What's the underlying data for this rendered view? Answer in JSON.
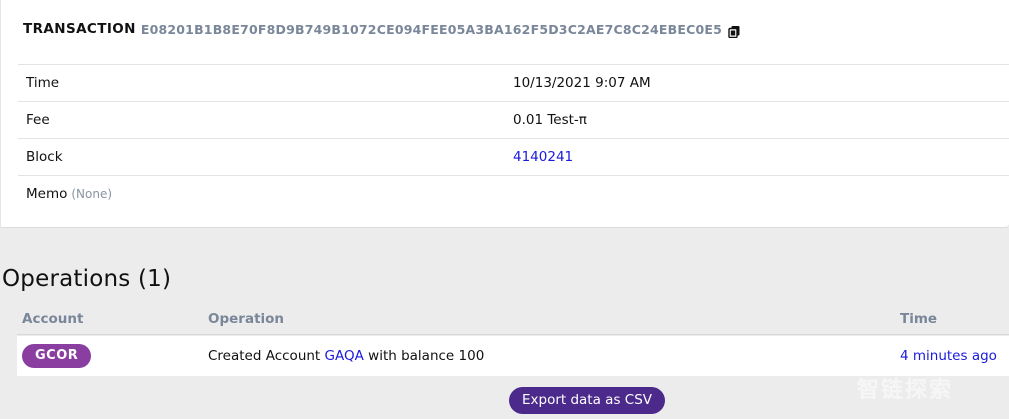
{
  "transaction": {
    "label": "TRANSACTION",
    "hash": "E08201B1B8E70F8D9B749B1072CE094FEE05A3BA162F5D3C2AE7C8C24EBEC0E5",
    "copy_icon": "clipboard-icon"
  },
  "details": {
    "time": {
      "label": "Time",
      "value": "10/13/2021 9:07 AM"
    },
    "fee": {
      "label": "Fee",
      "value": "0.01 Test-π"
    },
    "block": {
      "label": "Block",
      "value": "4140241"
    },
    "memo": {
      "label": "Memo",
      "value": "(None)"
    }
  },
  "operations": {
    "title": "Operations (1)",
    "columns": {
      "account": "Account",
      "operation": "Operation",
      "time": "Time"
    },
    "rows": [
      {
        "account": "GCOR",
        "op_prefix": "Created Account",
        "op_link": "GAQA",
        "op_suffix": "with balance 100",
        "time": "4 minutes ago"
      }
    ]
  },
  "export_label": "Export data as CSV",
  "watermark": "智链探索",
  "colors": {
    "link": "#1a1adb",
    "badge": "#8a3ea0",
    "button": "#4b2a8c",
    "muted": "#7a8699"
  }
}
